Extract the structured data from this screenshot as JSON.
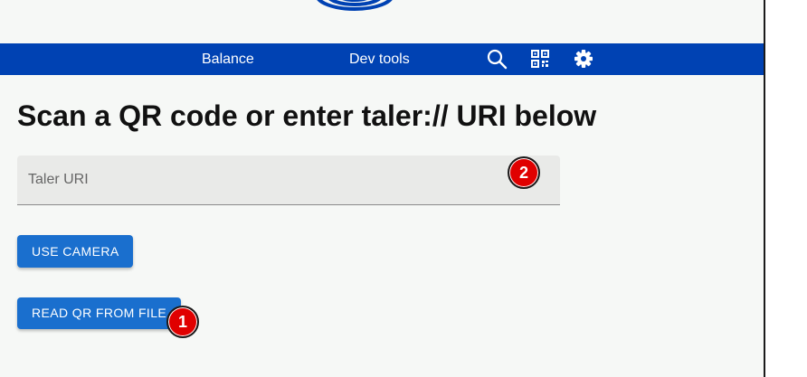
{
  "nav": {
    "items": [
      {
        "label": "Balance"
      },
      {
        "label": "Dev tools"
      }
    ],
    "icons": [
      "search-icon",
      "qr-code-icon",
      "gear-icon"
    ]
  },
  "main": {
    "title": "Scan a QR code or enter taler:// URI below",
    "uri_field": {
      "placeholder": "Taler URI",
      "value": ""
    },
    "buttons": {
      "use_camera": "USE CAMERA",
      "read_from_file": "READ QR FROM FILE"
    }
  },
  "markers": {
    "first": "1",
    "second": "2"
  },
  "colors": {
    "navbar": "#0042b3",
    "button": "#1a6fce",
    "background": "#f6f8f6",
    "badge": "#e00000"
  }
}
